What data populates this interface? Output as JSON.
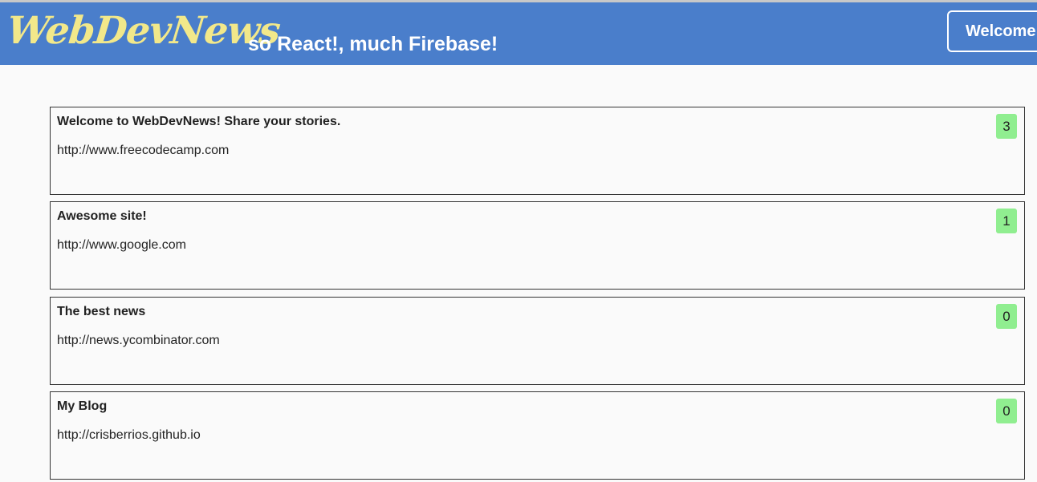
{
  "header": {
    "logo": "WebDevNews",
    "tagline": "so React!, much Firebase!",
    "welcome_label": "Welcome"
  },
  "stories": [
    {
      "title": "Welcome to WebDevNews! Share your stories.",
      "url": "http://www.freecodecamp.com",
      "votes": "3"
    },
    {
      "title": "Awesome site!",
      "url": "http://www.google.com",
      "votes": "1"
    },
    {
      "title": "The best news",
      "url": "http://news.ycombinator.com",
      "votes": "0"
    },
    {
      "title": "My Blog",
      "url": "http://crisberrios.github.io",
      "votes": "0"
    }
  ],
  "colors": {
    "header_bg": "#4a7ecb",
    "logo": "#f2e88a",
    "vote_badge": "#90ee90"
  }
}
